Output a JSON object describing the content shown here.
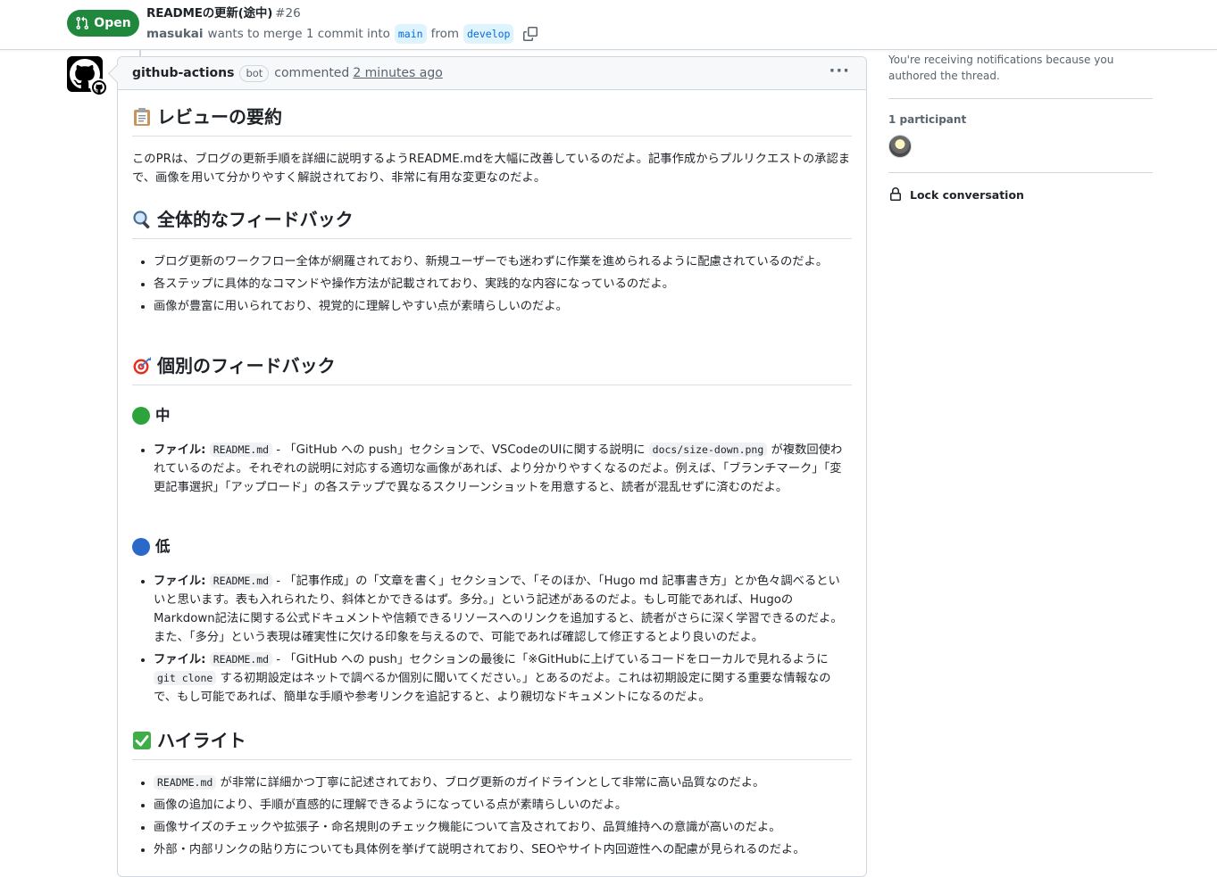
{
  "pr": {
    "state": "Open",
    "title": "READMEの更新(途中)",
    "number": "#26",
    "author": "masukai",
    "merge_text": "wants to merge 1 commit into",
    "base_branch": "main",
    "from_text": "from",
    "head_branch": "develop"
  },
  "comment": {
    "author": "github-actions",
    "bot_label": "bot",
    "action": "commented",
    "time": "2 minutes ago",
    "menu": "···"
  },
  "body": {
    "summary": {
      "heading": "レビューの要約",
      "text": "このPRは、ブログの更新手順を詳細に説明するようREADME.mdを大幅に改善しているのだよ。記事作成からプルリクエストの承認まで、画像を用いて分かりやすく解説されており、非常に有用な変更なのだよ。"
    },
    "overall": {
      "heading": "全体的なフィードバック",
      "items": [
        "ブログ更新のワークフロー全体が網羅されており、新規ユーザーでも迷わずに作業を進められるように配慮されているのだよ。",
        "各ステップに具体的なコマンドや操作方法が記載されており、実践的な内容になっているのだよ。",
        "画像が豊富に用いられており、視覚的に理解しやすい点が素晴らしいのだよ。"
      ]
    },
    "individual": {
      "heading": "個別のフィードバック",
      "medium": {
        "heading": "中",
        "file_label": "ファイル:",
        "file": "README.md",
        "dash": " - ",
        "text_a": "「GitHub への push」セクションで、VSCodeのUIに関する説明に",
        "code": "docs/size-down.png",
        "text_b": "が複数回使われているのだよ。それぞれの説明に対応する適切な画像があれば、より分かりやすくなるのだよ。例えば、「ブランチマーク」「変更記事選択」「アップロード」の各ステップで異なるスクリーンショットを用意すると、読者が混乱せずに済むのだよ。"
      },
      "low": {
        "heading": "低",
        "item1": {
          "file_label": "ファイル:",
          "file": "README.md",
          "dash": " - ",
          "text": "「記事作成」の「文章を書く」セクションで、「そのほか、「Hugo md 記事書き方」とか色々調べるといいと思います。表も入れられたり、斜体とかできるはず。多分。」という記述があるのだよ。もし可能であれば、HugoのMarkdown記法に関する公式ドキュメントや信頼できるリソースへのリンクを追加すると、読者がさらに深く学習できるのだよ。また、「多分」という表現は確実性に欠ける印象を与えるので、可能であれば確認して修正するとより良いのだよ。"
        },
        "item2": {
          "file_label": "ファイル:",
          "file": "README.md",
          "dash": " - ",
          "text_a": "「GitHub への push」セクションの最後に「※GitHubに上げているコードをローカルで見れるように",
          "code": "git clone",
          "text_b": "する初期設定はネットで調べるか個別に聞いてください。」とあるのだよ。これは初期設定に関する重要な情報なので、もし可能であれば、簡単な手順や参考リンクを追記すると、より親切なドキュメントになるのだよ。"
        }
      }
    },
    "highlights": {
      "heading": "ハイライト",
      "item1_code": "README.md",
      "item1_text": "が非常に詳細かつ丁寧に記述されており、ブログ更新のガイドラインとして非常に高い品質なのだよ。",
      "item2": "画像の追加により、手順が直感的に理解できるようになっている点が素晴らしいのだよ。",
      "item3": "画像サイズのチェックや拡張子・命名規則のチェック機能について言及されており、品質維持への意識が高いのだよ。",
      "item4": "外部・内部リンクの貼り方についても具体例を挙げて説明されており、SEOやサイト内回遊性への配慮が見られるのだよ。"
    }
  },
  "sidebar": {
    "notification_text": "You're receiving notifications because you authored the thread.",
    "participants_heading": "1 participant",
    "lock_label": "Lock conversation"
  },
  "colors": {
    "open_green": "#1f883d",
    "link_blue": "#0969da",
    "border": "#d0d7de",
    "muted": "#59636e"
  }
}
